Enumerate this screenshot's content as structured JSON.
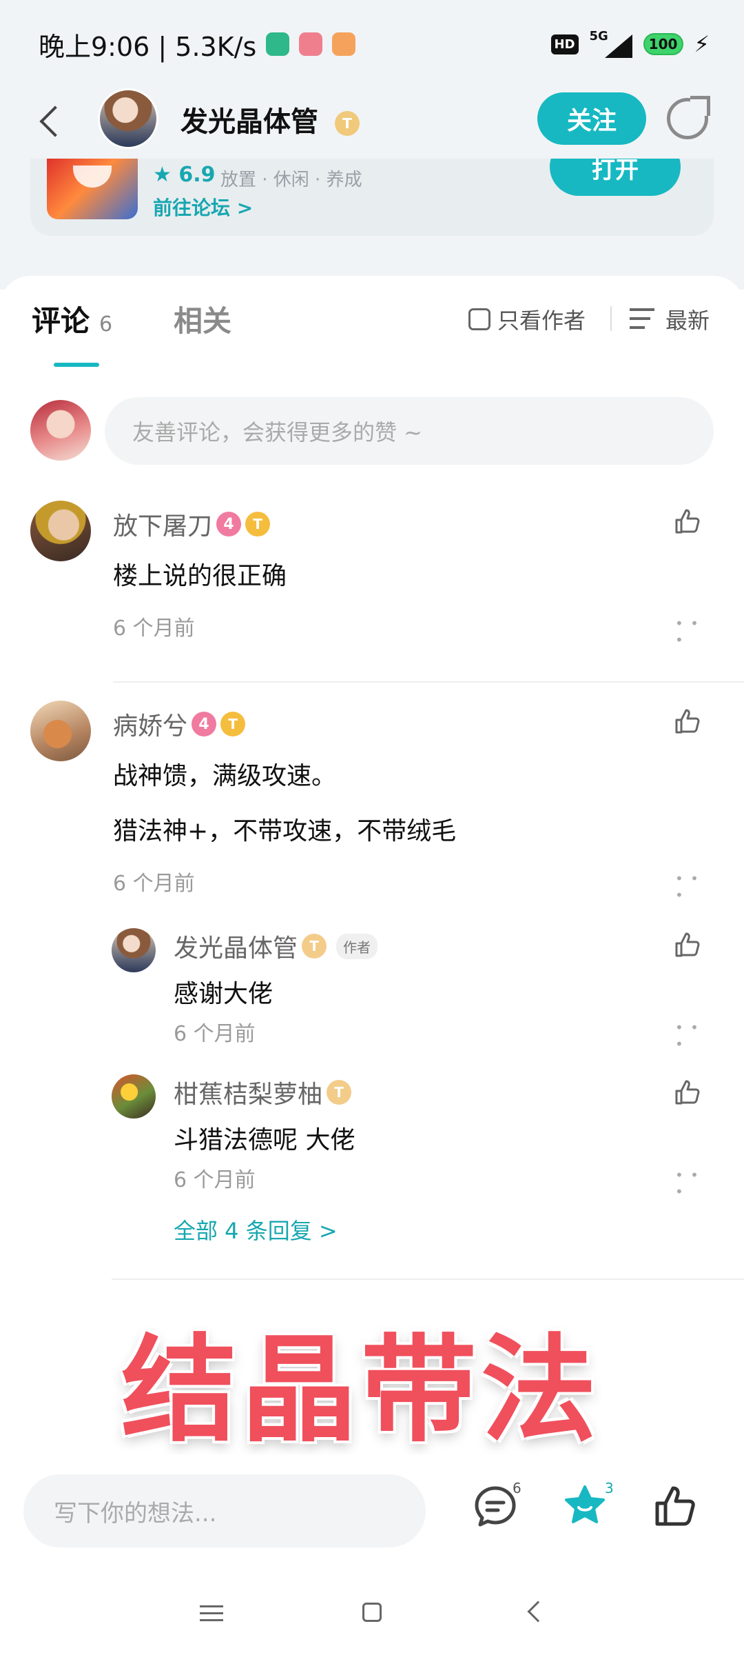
{
  "status_bar": {
    "time_speed": "晚上9:06 | 5.3K/s",
    "network": "5G",
    "hd": "HD",
    "battery": "100"
  },
  "header": {
    "author_name": "发光晶体管",
    "author_level": "T",
    "follow_label": "关注"
  },
  "game_card": {
    "rating": "★ 6.9",
    "tags": "放置 · 休闲 · 养成",
    "forum_link": "前往论坛 >",
    "open_label": "打开"
  },
  "tabs": {
    "comments_label": "评论",
    "comments_count": "6",
    "related_label": "相关",
    "only_author_label": "只看作者",
    "sort_label": "最新"
  },
  "comment_input": {
    "placeholder": "友善评论，会获得更多的赞 ~"
  },
  "comments": [
    {
      "username": "放下屠刀",
      "level": "4",
      "coin": "T",
      "text": "楼上说的很正确",
      "time": "6 个月前"
    },
    {
      "username": "病娇兮",
      "level": "4",
      "coin": "T",
      "text_line1": "战神馈，满级攻速。",
      "text_line2": "猎法神+，不带攻速，不带绒毛",
      "time": "6 个月前",
      "replies": [
        {
          "username": "发光晶体管",
          "coin": "T",
          "tag": "作者",
          "text": "感谢大佬",
          "time": "6 个月前"
        },
        {
          "username": "柑蕉桔梨萝柚",
          "coin": "T",
          "text": "斗猎法德呢 大佬",
          "time": "6 个月前"
        }
      ],
      "all_replies_label": "全部 4 条回复 >"
    }
  ],
  "overlay": {
    "title": "结晶带法"
  },
  "bottom_bar": {
    "placeholder": "写下你的想法...",
    "comment_count": "6",
    "star_count": "3"
  },
  "colors": {
    "accent": "#17b8c2",
    "overlay_red": "#f04f5c"
  }
}
